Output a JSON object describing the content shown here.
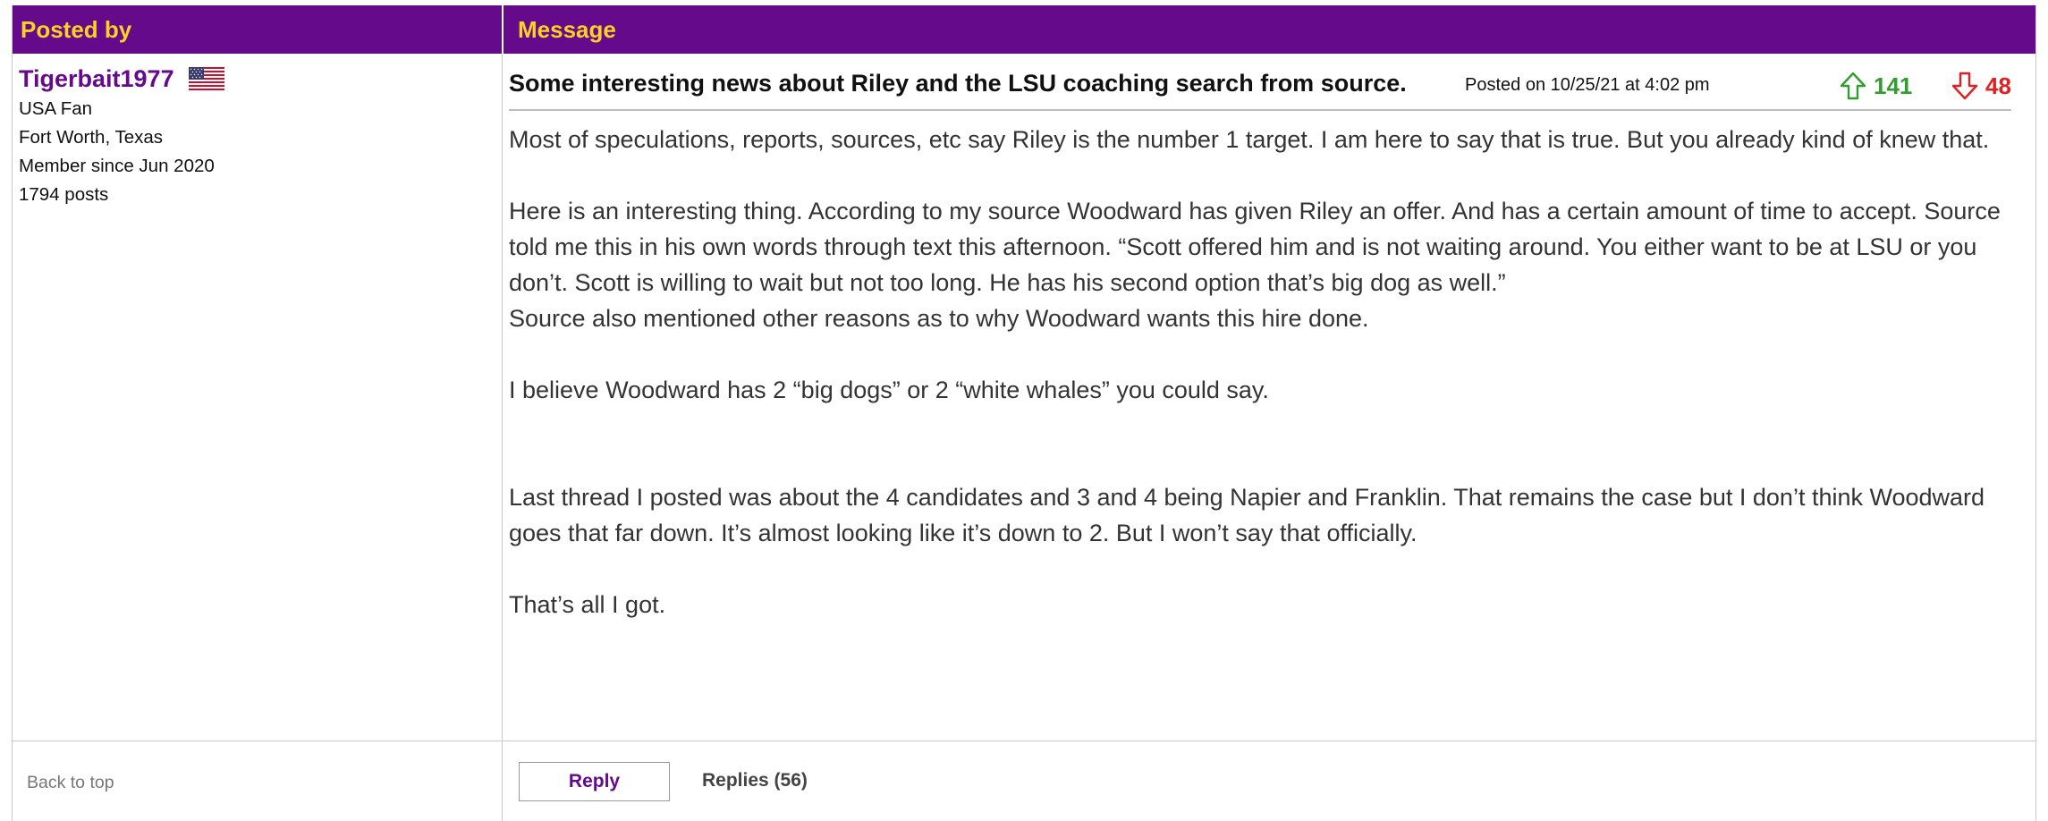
{
  "header": {
    "posted_by": "Posted by",
    "message": "Message"
  },
  "user": {
    "name": "Tigerbait1977",
    "flag_icon": "us-flag-icon",
    "fan_type": "USA Fan",
    "location": "Fort Worth, Texas",
    "member_since": "Member since Jun 2020",
    "posts": "1794 posts"
  },
  "post": {
    "title": "Some interesting news about Riley and the LSU coaching search from source.",
    "posted_on": "Posted on 10/25/21 at 4:02 pm",
    "upvotes": "141",
    "downvotes": "48",
    "paragraphs": [
      "Most of speculations, reports, sources, etc say Riley is the number 1 target. I am here to say that is true. But you already kind of knew that.",
      "Here is an interesting thing. According to my source Woodward has given Riley an offer. And has a certain amount of time to accept. Source told me this in his own words through text this afternoon. “Scott offered him and is not waiting around. You either want to be at LSU or you don’t. Scott is willing to wait but not too long. He has his second option that’s big dog as well.”",
      "Source also mentioned other reasons as to why Woodward wants this hire done.",
      "I believe Woodward has 2 “big dogs” or 2 “white whales” you could say.",
      "Last thread I posted was about the 4 candidates and 3 and 4 being Napier and Franklin. That remains the case but I don’t think Woodward goes that far down. It’s almost looking like it’s down to 2. But I won’t say that officially.",
      "That’s all I got."
    ]
  },
  "footer": {
    "back_to_top": "Back to top",
    "reply_label": "Reply",
    "replies_label": "Replies (56)"
  },
  "colors": {
    "header_bg": "#660a8c",
    "header_text": "#fdd023",
    "upvote": "#2f9e2f",
    "downvote": "#e02020"
  }
}
